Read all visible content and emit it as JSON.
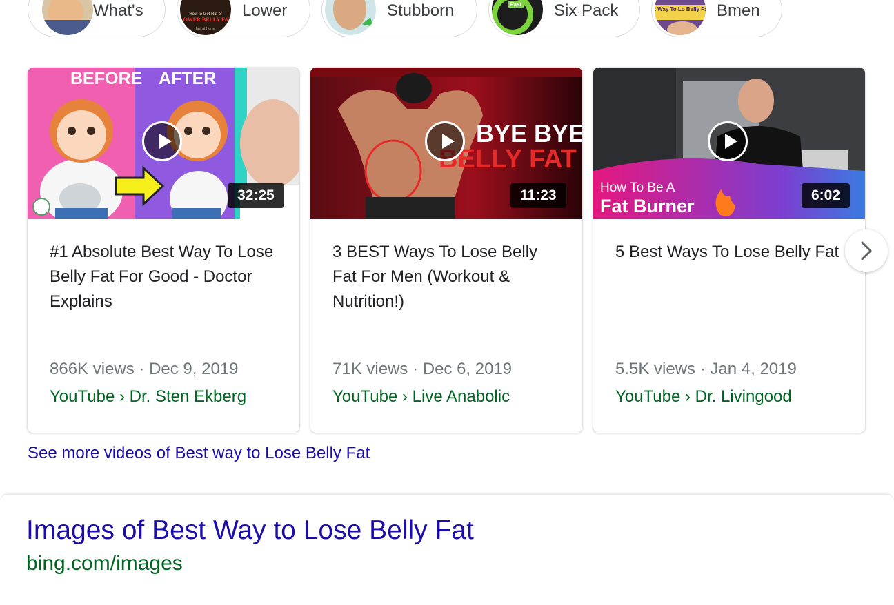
{
  "chips": [
    {
      "label": "What's",
      "thumb_text": ""
    },
    {
      "label": "Lower",
      "thumb_text": "LOWER BELLY FAT",
      "thumb_caption": "How to Get Rid of",
      "thumb_footer": "fast at Home"
    },
    {
      "label": "Stubborn",
      "thumb_text": ""
    },
    {
      "label": "Six Pack",
      "thumb_text": "Fast"
    },
    {
      "label": "Bmen",
      "thumb_text": "st Way To Lo Belly Fat"
    }
  ],
  "videos": [
    {
      "duration": "32:25",
      "title": "#1 Absolute Best Way To Lose Belly Fat For Good - Doctor Explains",
      "views": "866K views",
      "date": "Dec 9, 2019",
      "source": "YouTube",
      "channel": "Dr. Sten Ekberg",
      "thumb_before": "BEFORE",
      "thumb_after": "AFTER"
    },
    {
      "duration": "11:23",
      "title": "3 BEST Ways To Lose Belly Fat For Men (Workout & Nutrition!)",
      "views": "71K views",
      "date": "Dec 6, 2019",
      "source": "YouTube",
      "channel": "Live Anabolic",
      "thumb_line1": "BYE BYE",
      "thumb_line2": "BELLY FAT"
    },
    {
      "duration": "6:02",
      "title": "5 Best Ways To Lose Belly Fat",
      "views": "5.5K views",
      "date": "Jan 4, 2019",
      "source": "YouTube",
      "channel": "Dr. Livingood",
      "thumb_line1": "How To Be A",
      "thumb_line2": "Fat Burner"
    }
  ],
  "separator_dot": "·",
  "breadcrumb_sep": "›",
  "see_more": "See more videos of Best way to Lose Belly Fat",
  "images_section": {
    "heading": "Images of Best Way to Lose Belly Fat",
    "url": "bing.com/images"
  },
  "colors": {
    "link": "#1a0dab",
    "url_green": "#006621",
    "meta_gray": "#70757a"
  }
}
